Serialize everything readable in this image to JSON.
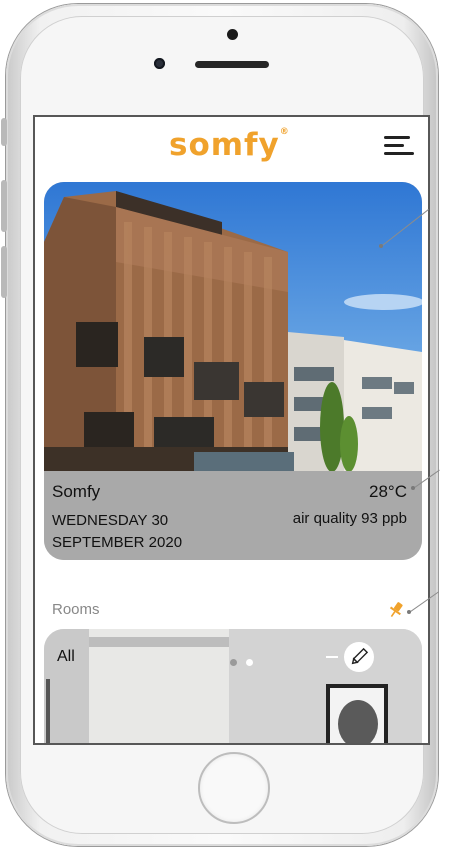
{
  "app": {
    "brand": "somfy",
    "brand_mark": "®"
  },
  "home_card": {
    "name": "Somfy",
    "temperature": "28°C",
    "date_line1": "WEDNESDAY 30",
    "date_line2": "SEPTEMBER 2020",
    "air_quality": "air quality 93 ppb"
  },
  "rooms": {
    "section_label": "Rooms",
    "first_room_label": "All"
  },
  "icons": {
    "menu": "hamburger-menu-icon",
    "pin": "pin-icon",
    "edit": "pencil-icon"
  },
  "colors": {
    "brand": "#f0a22c",
    "card_info_bg": "#a9a9a9",
    "section_label": "#888888",
    "screen_border": "#575757"
  }
}
